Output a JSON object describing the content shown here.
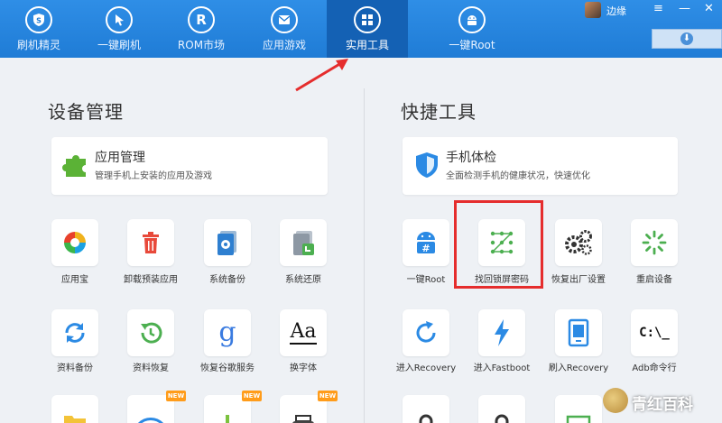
{
  "nav": {
    "items": [
      {
        "label": "刷机精灵",
        "icon": "shield-s-icon"
      },
      {
        "label": "一键刷机",
        "icon": "cursor-icon"
      },
      {
        "label": "ROM市场",
        "icon": "r-icon"
      },
      {
        "label": "应用游戏",
        "icon": "envelope-icon"
      },
      {
        "label": "实用工具",
        "icon": "grid-icon",
        "active": true
      },
      {
        "label": "一键Root",
        "icon": "android-icon"
      }
    ],
    "username": "边缘",
    "window_controls": [
      "≡",
      "—",
      "✕"
    ]
  },
  "left_section": {
    "title": "设备管理",
    "card": {
      "title": "应用管理",
      "subtitle": "管理手机上安装的应用及游戏"
    },
    "tiles": [
      {
        "label": "应用宝"
      },
      {
        "label": "卸载预装应用"
      },
      {
        "label": "系统备份"
      },
      {
        "label": "系统还原"
      },
      {
        "label": "资料备份"
      },
      {
        "label": "资料恢复"
      },
      {
        "label": "恢复谷歌服务"
      },
      {
        "label": "换字体",
        "glyph": "Aa"
      }
    ],
    "badges": {
      "new": "NEW"
    }
  },
  "right_section": {
    "title": "快捷工具",
    "card": {
      "title": "手机体检",
      "subtitle": "全面检测手机的健康状况，快速优化"
    },
    "tiles": [
      {
        "label": "一键Root"
      },
      {
        "label": "找回锁屏密码"
      },
      {
        "label": "恢复出厂设置"
      },
      {
        "label": "重启设备"
      },
      {
        "label": "进入Recovery"
      },
      {
        "label": "进入Fastboot"
      },
      {
        "label": "刷入Recovery"
      },
      {
        "label": "Adb命令行",
        "glyph": "C:\\_"
      }
    ]
  },
  "watermark": "青红百科",
  "colors": {
    "nav_bg": "#1f7cd6",
    "nav_active": "#1461b4",
    "highlight": "#e52d2d",
    "accent_blue": "#2b8ae4"
  }
}
